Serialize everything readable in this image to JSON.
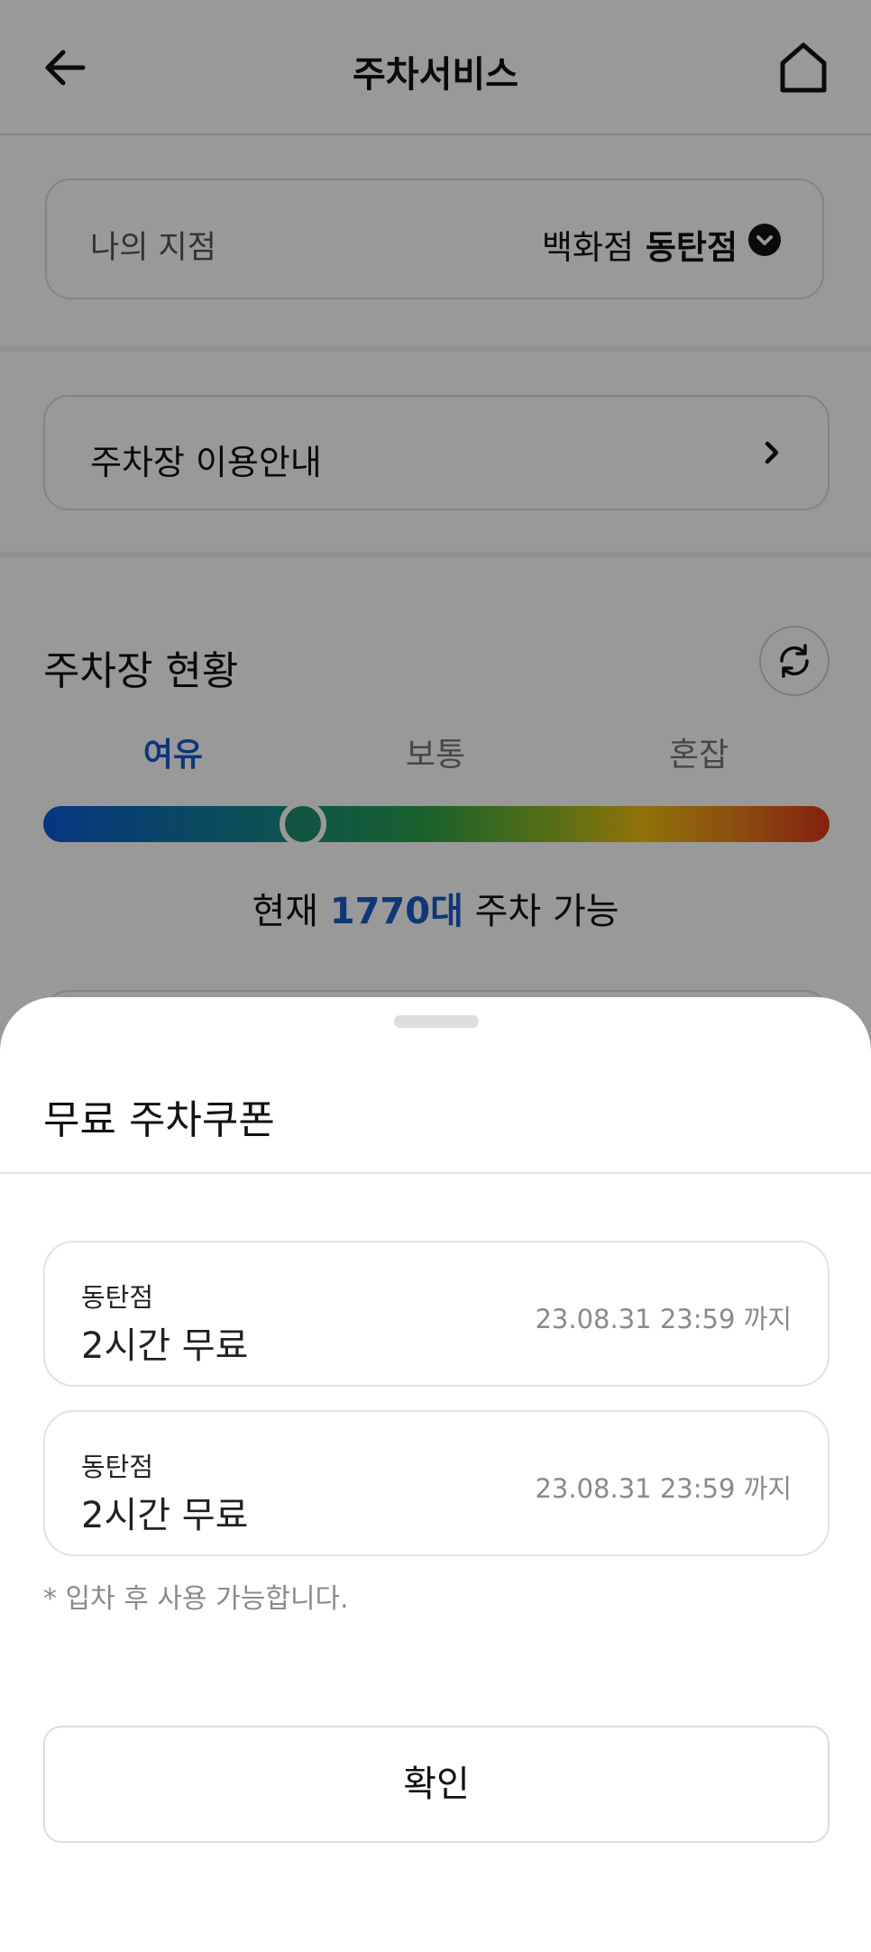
{
  "header": {
    "title": "주차서비스",
    "back_icon": "arrow-left-icon",
    "home_icon": "home-icon"
  },
  "branch": {
    "label": "나의 지점",
    "value_prefix": "백화점",
    "value_name": "동탄점",
    "chevron_icon": "chevron-down-circle-icon"
  },
  "guide": {
    "label": "주차장 이용안내",
    "chevron_icon": "chevron-right-icon"
  },
  "status": {
    "title": "주차장 현황",
    "refresh_icon": "refresh-icon",
    "levels": [
      "여유",
      "보통",
      "혼잡"
    ],
    "active_level": "여유",
    "gauge_level": 0.33,
    "available_prefix": "현재",
    "available_count": "1770대",
    "available_suffix": "주차 가능"
  },
  "sheet": {
    "title": "무료 주차쿠폰",
    "coupons": [
      {
        "branch": "동탄점",
        "title": "2시간 무료",
        "expiry": "23.08.31 23:59 까지"
      },
      {
        "branch": "동탄점",
        "title": "2시간 무료",
        "expiry": "23.08.31 23:59 까지"
      }
    ],
    "notice": "* 입차 후 사용 가능합니다.",
    "confirm_label": "확인"
  },
  "colors": {
    "accent": "#1a5cc8",
    "gauge_knob": "#1e8c6e",
    "muted_text": "#8a8a8a"
  }
}
